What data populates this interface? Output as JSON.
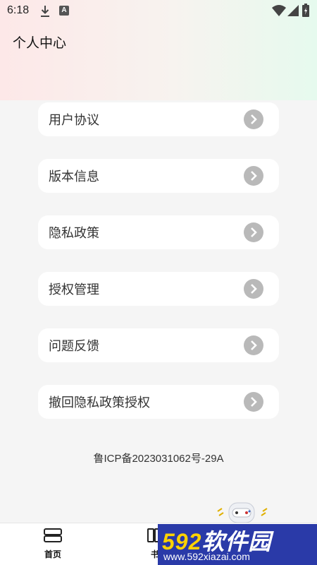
{
  "status_bar": {
    "time": "6:18",
    "a_badge": "A"
  },
  "header": {
    "title": "个人中心"
  },
  "menu": {
    "items": [
      {
        "label": "用户协议"
      },
      {
        "label": "版本信息"
      },
      {
        "label": "隐私政策"
      },
      {
        "label": "授权管理"
      },
      {
        "label": "问题反馈"
      },
      {
        "label": "撤回隐私政策授权"
      }
    ]
  },
  "footer": {
    "icp": "鲁ICP备2023031062号-29A"
  },
  "tabbar": {
    "tabs": [
      {
        "label": "首页",
        "icon": "book-stack-icon"
      },
      {
        "label": "书",
        "icon": "bookshelf-icon"
      }
    ]
  },
  "watermark": {
    "brand_num": "592",
    "brand_text": "软件园",
    "url": "www.592xiazai.com"
  }
}
